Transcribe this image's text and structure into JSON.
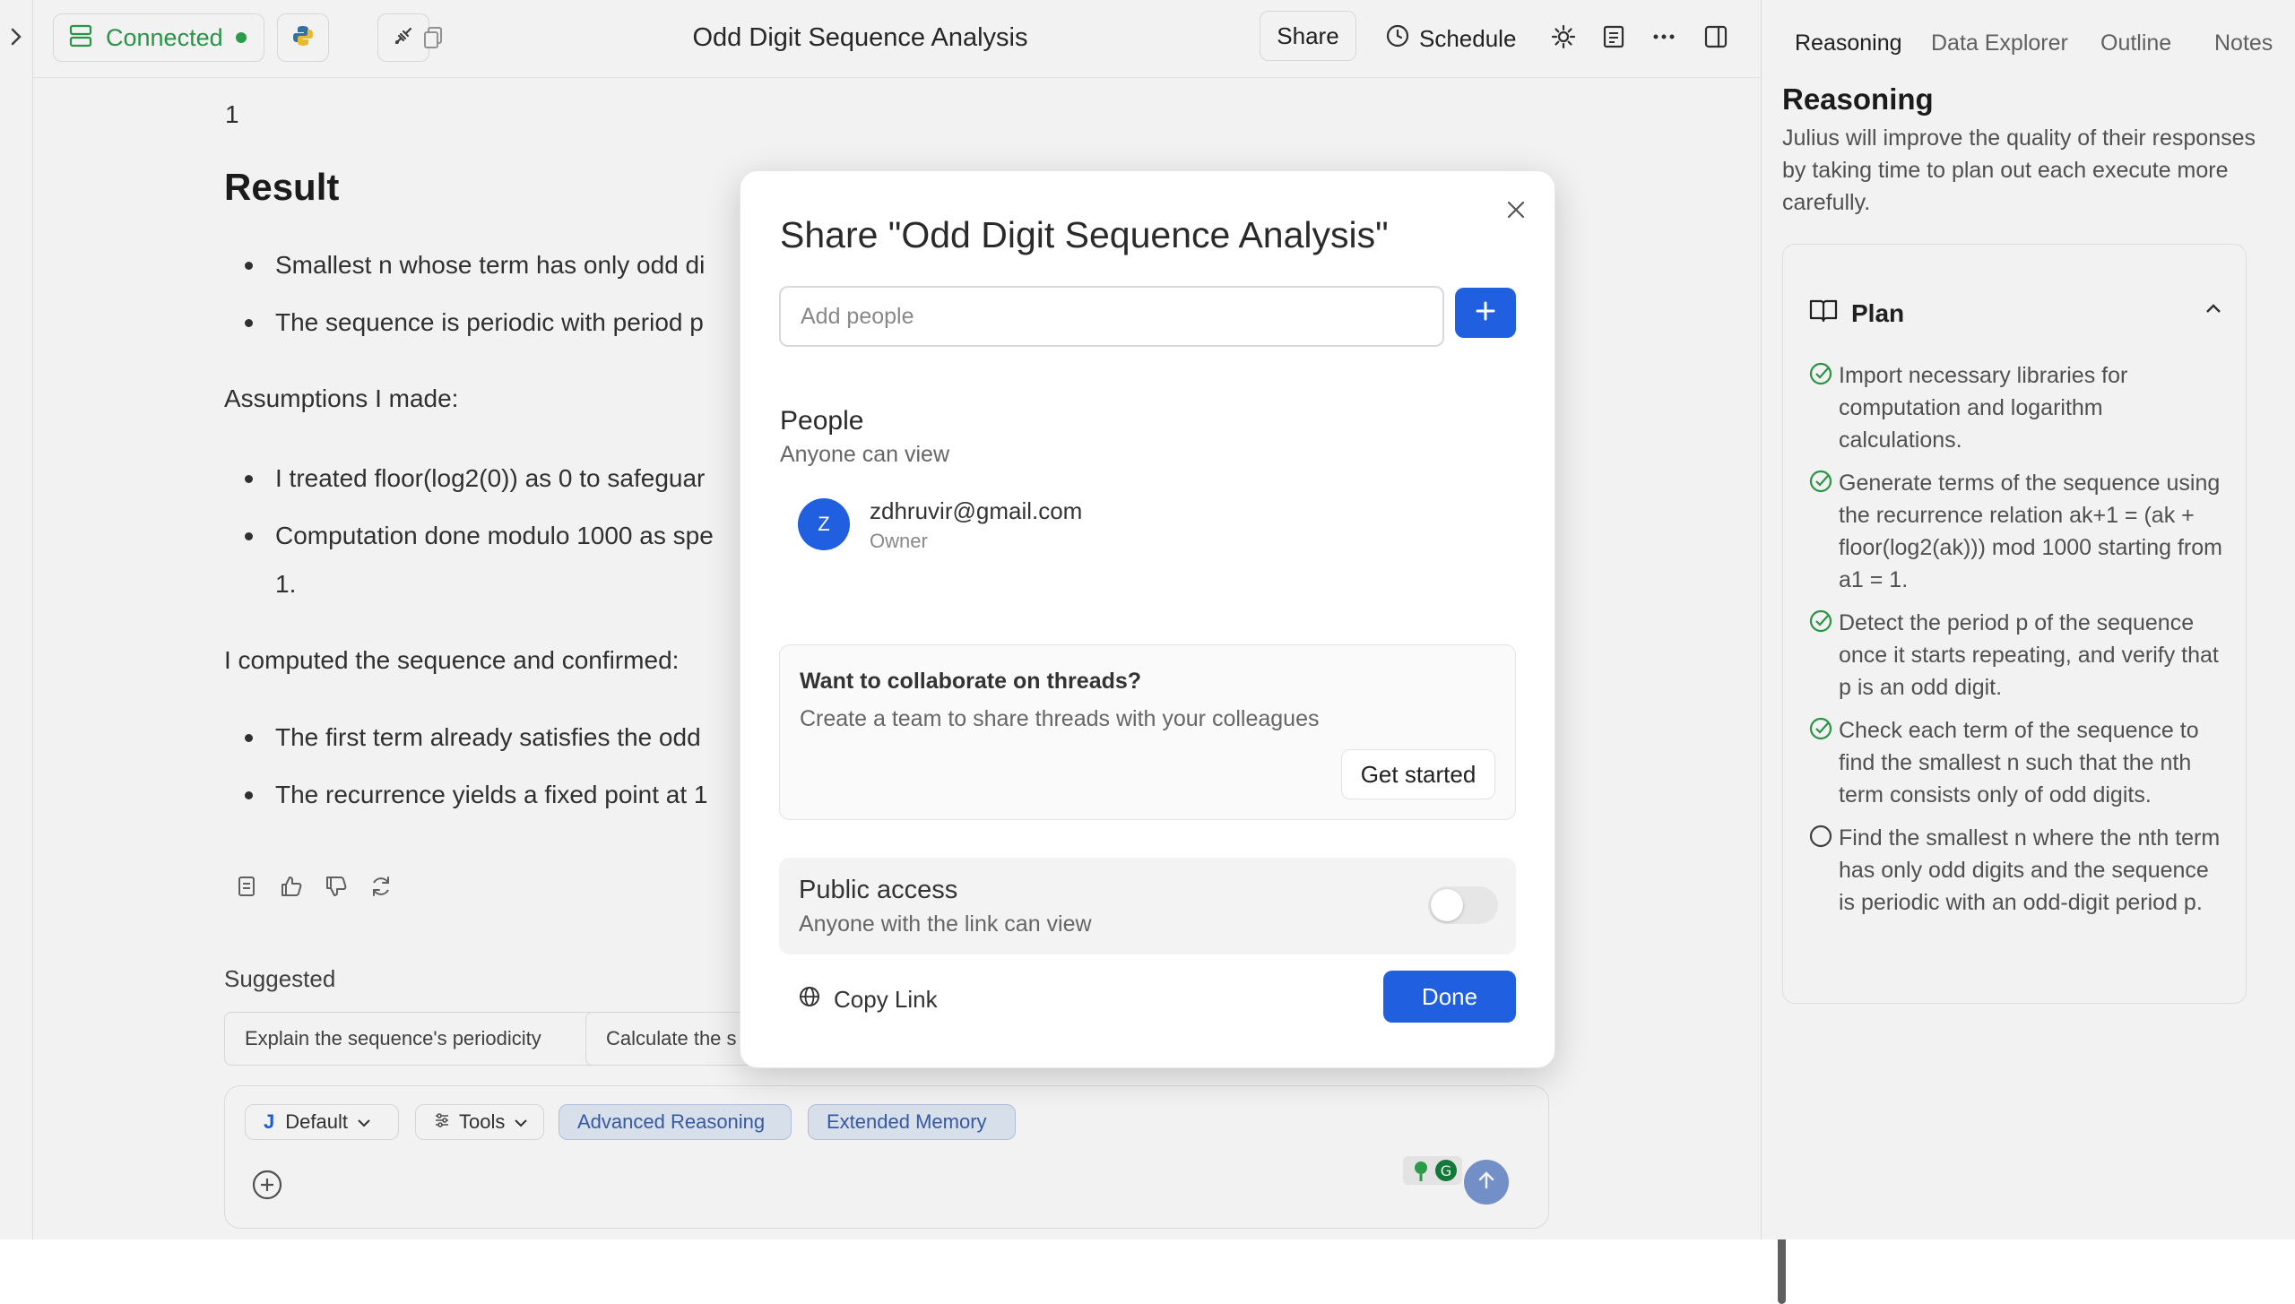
{
  "topbar": {
    "connection_label": "Connected",
    "doc_title": "Odd Digit Sequence Analysis",
    "share_label": "Share",
    "schedule_label": "Schedule"
  },
  "chat": {
    "partial_line": "1",
    "result_heading": "Result",
    "result_bullets": [
      "Smallest n whose term has only odd di",
      "The sequence is periodic with period p"
    ],
    "assumptions_heading": "Assumptions I made:",
    "assumption_bullets": [
      "I treated floor(log2(0)) as 0 to safeguar",
      "Computation done modulo 1000 as spe"
    ],
    "assumption_continuation": "1.",
    "confirm_heading": "I computed the sequence and confirmed:",
    "confirm_bullets": [
      "The first term already satisfies the odd",
      "The recurrence yields a fixed point at 1"
    ],
    "suggested_label": "Suggested",
    "suggestions": [
      "Explain the sequence's periodicity",
      "Calculate the s"
    ]
  },
  "composer": {
    "model_initial": "J",
    "model_label": "Default",
    "tools_label": "Tools",
    "pills": [
      "Advanced Reasoning",
      "Extended Memory"
    ]
  },
  "right_panel": {
    "tabs": [
      "Reasoning",
      "Data Explorer",
      "Outline",
      "Notes"
    ],
    "active_tab": "Reasoning",
    "title": "Reasoning",
    "description": "Julius will improve the quality of their responses by taking time to plan out each execute more carefully.",
    "plan_label": "Plan",
    "plan_items": [
      {
        "text": "Import necessary libraries for computation and logarithm calculations.",
        "done": true
      },
      {
        "text": "Generate terms of the sequence using the recurrence relation ak+1 = (ak + floor(log2(ak))) mod 1000 starting from a1 = 1.",
        "done": true
      },
      {
        "text": "Detect the period p of the sequence once it starts repeating, and verify that p is an odd digit.",
        "done": true
      },
      {
        "text": "Check each term of the sequence to find the smallest n such that the nth term consists only of odd digits.",
        "done": true
      },
      {
        "text": "Find the smallest n where the nth term has only odd digits and the sequence is periodic with an odd-digit period p.",
        "done": false
      }
    ]
  },
  "modal": {
    "title": "Share \"Odd Digit Sequence Analysis\"",
    "input_placeholder": "Add people",
    "people_label": "People",
    "people_sub": "Anyone can view",
    "member": {
      "initial": "Z",
      "email": "zdhruvir@gmail.com",
      "role": "Owner"
    },
    "collab_title": "Want to collaborate on threads?",
    "collab_sub": "Create a team to share threads with your colleagues",
    "get_started_label": "Get started",
    "public_title": "Public access",
    "public_sub": "Anyone with the link can view",
    "public_enabled": false,
    "copy_link_label": "Copy Link",
    "done_label": "Done"
  },
  "colors": {
    "accent": "#1f5fe0",
    "connected": "#2e9b49",
    "pill_bg": "#e3ebf8"
  }
}
